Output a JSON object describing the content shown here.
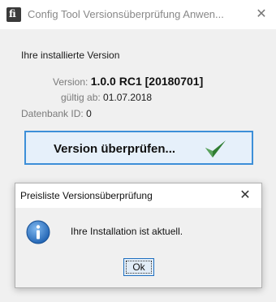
{
  "window": {
    "title": "Config Tool Versionsüberprüfung Anwen...",
    "app_icon_glyph": "fi",
    "close_glyph": "✕"
  },
  "version_info": {
    "section_header": "Ihre installierte Version",
    "version_label": "Version:",
    "version_value": "1.0.0 RC1 [20180701]",
    "valid_from_label": "gültig ab:",
    "valid_from_value": "01.07.2018",
    "database_label": "Datenbank ID:",
    "database_value": "0"
  },
  "check_button": {
    "label": "Version überprüfen...",
    "icon": "checkmark-icon",
    "accent_color": "#3d8fd8"
  },
  "dialog": {
    "title": "Preisliste Versionsüberprüfung",
    "close_glyph": "✕",
    "icon": "info-icon",
    "message": "Ihre Installation ist aktuell.",
    "ok_label": "Ok"
  }
}
